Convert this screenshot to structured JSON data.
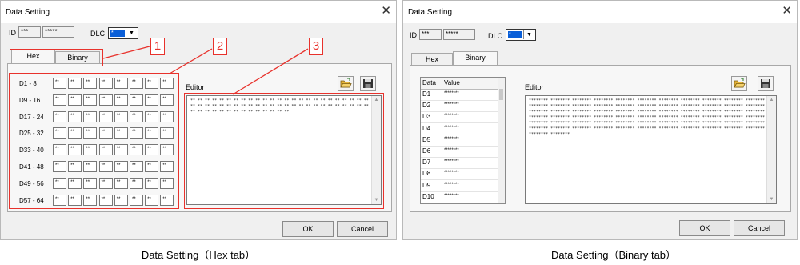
{
  "hex_dialog": {
    "title": "Data Setting",
    "id_label": "ID",
    "id_value1": "***",
    "id_value2": "*****",
    "dlc_label": "DLC",
    "dlc_value": "*",
    "tabs": [
      "Hex",
      "Binary"
    ],
    "rows": [
      "D1 - 8",
      "D9 - 16",
      "D17 - 24",
      "D25 - 32",
      "D33 - 40",
      "D41 - 48",
      "D49 - 56",
      "D57 - 64"
    ],
    "cell_value": "**",
    "editor_label": "Editor",
    "editor_text": "** ** ** ** ** ** ** ** ** ** ** ** ** ** ** ** ** ** ** ** ** ** ** ** ** ** ** ** ** ** ** ** ** ** ** ** ** ** ** ** ** ** ** ** ** ** ** ** ** ** ** ** ** ** ** ** ** ** ** ** ** ** ** **",
    "ok": "OK",
    "cancel": "Cancel",
    "callouts": [
      "1",
      "2",
      "3"
    ]
  },
  "binary_dialog": {
    "title": "Data Setting",
    "id_label": "ID",
    "id_value1": "***",
    "id_value2": "*****",
    "dlc_label": "DLC",
    "dlc_value": "*",
    "tabs": [
      "Hex",
      "Binary"
    ],
    "grid_headers": [
      "Data",
      "Value"
    ],
    "grid_rows": [
      [
        "D1",
        "********"
      ],
      [
        "D2",
        "********"
      ],
      [
        "D3",
        "********"
      ],
      [
        "D4",
        "********"
      ],
      [
        "D5",
        "********"
      ],
      [
        "D6",
        "********"
      ],
      [
        "D7",
        "********"
      ],
      [
        "D8",
        "********"
      ],
      [
        "D9",
        "********"
      ],
      [
        "D10",
        "********"
      ]
    ],
    "editor_label": "Editor",
    "editor_text": "******** ******** ******** ******** ******** ******** ******** ******** ******** ******** ******** ******** ******** ******** ******** ******** ******** ******** ******** ******** ******** ******** ******** ******** ******** ******** ******** ******** ******** ******** ******** ******** ******** ******** ******** ******** ******** ******** ******** ******** ******** ******** ******** ******** ******** ******** ******** ******** ******** ******** ******** ******** ******** ******** ******** ******** ******** ******** ******** ******** ******** ******** ******** ******** ******** ******** ******** ********",
    "ok": "OK",
    "cancel": "Cancel"
  },
  "captions": {
    "hex": "Data Setting（Hex tab）",
    "binary": "Data Setting（Binary tab）"
  },
  "colors": {
    "callout_red": "#e8322c",
    "dlc_blue": "#0a5fd8"
  },
  "icons": [
    "open-folder-icon",
    "save-disk-icon",
    "close-icon",
    "chevron-down-icon"
  ]
}
